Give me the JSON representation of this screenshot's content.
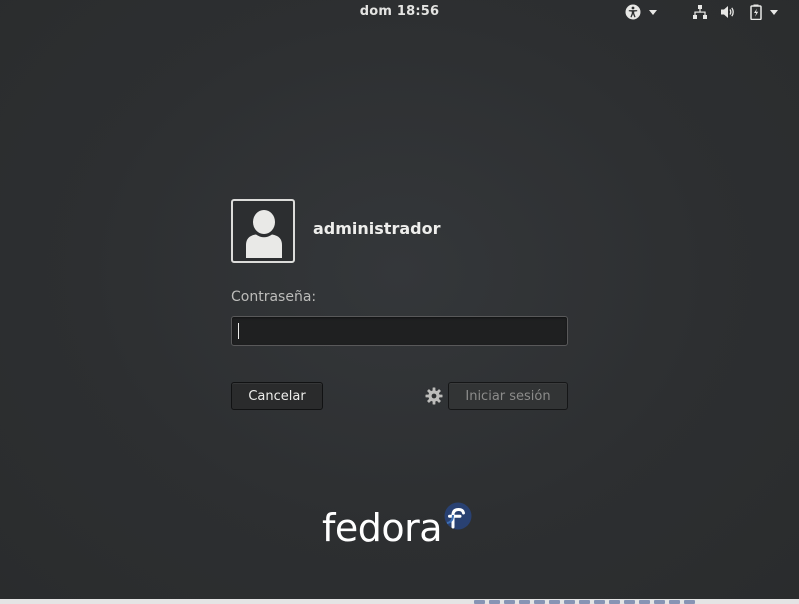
{
  "topbar": {
    "clock": "dom 18:56",
    "icons": [
      "accessibility-icon",
      "network-icon",
      "volume-icon",
      "battery-icon"
    ]
  },
  "login": {
    "username": "administrador",
    "password_label": "Contraseña:",
    "password_value": "",
    "cancel_label": "Cancelar",
    "signin_label": "Iniciar sesión",
    "session_icon": "gear-icon"
  },
  "branding": {
    "logo_text": "fedora",
    "logo_mark_color": "#294172"
  },
  "colors": {
    "background": "#2e3031",
    "text": "#eeeeec",
    "input_bg": "#1f2021",
    "disabled_text": "#8c8c8b"
  }
}
